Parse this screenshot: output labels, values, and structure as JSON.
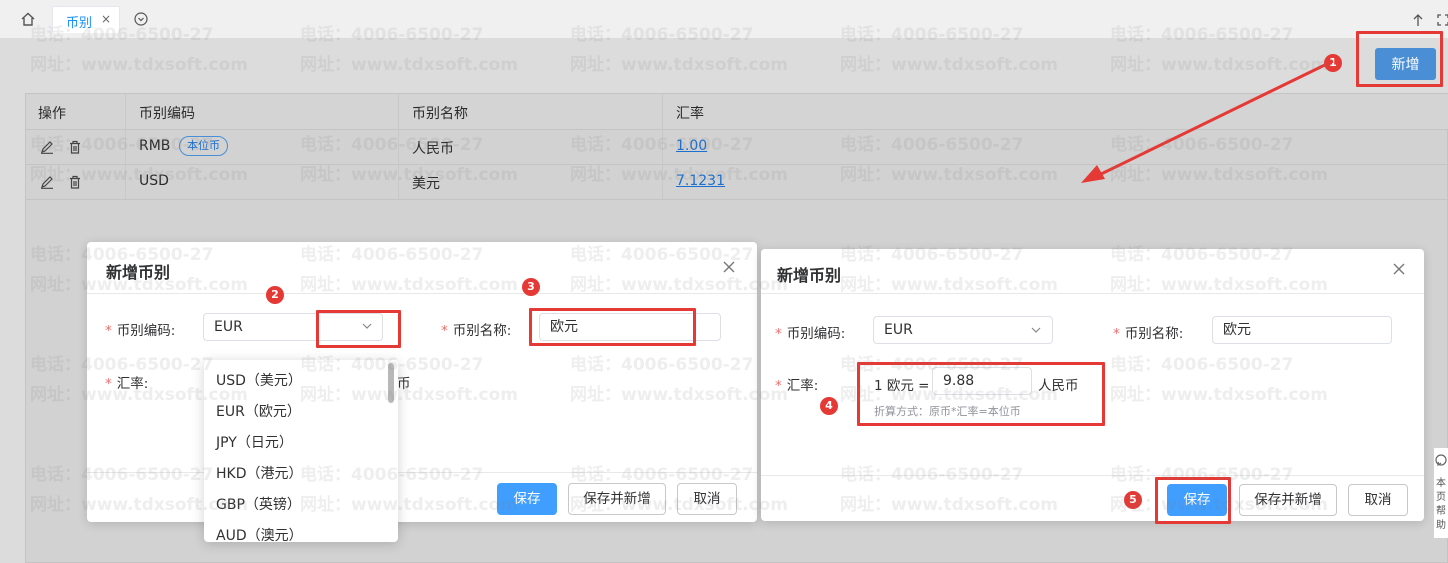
{
  "tabs": {
    "active_label": "币别",
    "close_glyph": "×"
  },
  "icons": {
    "home": "home-icon",
    "tab_menu": "chevron-down-circle-icon",
    "up": "arrow-up-icon",
    "expand": "expand-icon",
    "edit": "pencil-icon",
    "delete": "trash-icon",
    "close": "close-icon"
  },
  "toolbar": {
    "add_label": "新增"
  },
  "table": {
    "headers": [
      "操作",
      "币别编码",
      "币别名称",
      "汇率"
    ],
    "rows": [
      {
        "code": "RMB",
        "badge": "本位币",
        "name": "人民币",
        "rate": "1.00"
      },
      {
        "code": "USD",
        "badge": "",
        "name": "美元",
        "rate": "7.1231"
      }
    ]
  },
  "dialog_left": {
    "title": "新增币别",
    "code_label": "币别编码:",
    "code_value": "EUR",
    "name_label": "币别名称:",
    "name_value": "欧元",
    "rate_label": "汇率:",
    "rate_suffix_partial": "币",
    "options": [
      "USD（美元）",
      "EUR（欧元）",
      "JPY（日元）",
      "HKD（港元）",
      "GBP（英镑）",
      "AUD（澳元）"
    ],
    "save_label": "保存",
    "save_new_label": "保存并新增",
    "cancel_label": "取消"
  },
  "dialog_right": {
    "title": "新增币别",
    "code_label": "币别编码:",
    "code_value": "EUR",
    "name_label": "币别名称:",
    "name_value": "欧元",
    "rate_label": "汇率:",
    "rate_prefix": "1 欧元 =",
    "rate_value": "9.88",
    "rate_suffix": "人民币",
    "formula": "折算方式：原币*汇率=本位币",
    "save_label": "保存",
    "save_new_label": "保存并新增",
    "cancel_label": "取消"
  },
  "annotations": [
    "1",
    "2",
    "3",
    "4",
    "5"
  ],
  "side_text": [
    "本",
    "页",
    "帮",
    "助"
  ],
  "watermark": {
    "phone": "电话：4006-6500-27",
    "site": "网址：www.tdxsoft.com"
  },
  "colors": {
    "primary": "#409eff",
    "annotation": "#e53935",
    "link": "#1a6fcf"
  }
}
